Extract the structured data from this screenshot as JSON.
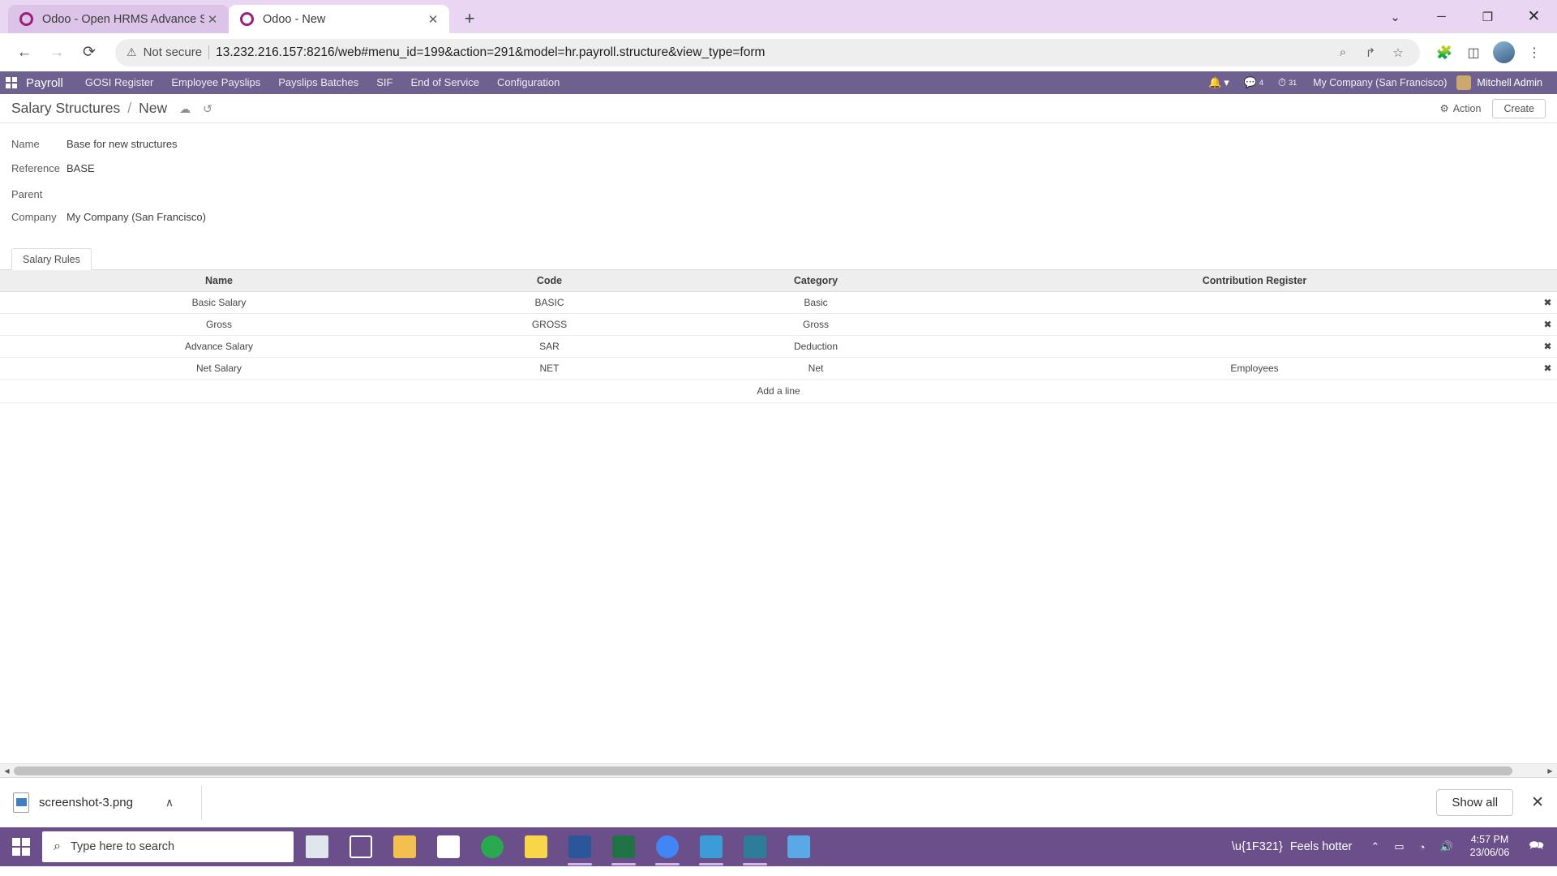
{
  "browser": {
    "tabs": [
      {
        "title": "Odoo - Open HRMS Advance Sal",
        "favicon": "odoo-favicon",
        "active": false,
        "close_label": "✕"
      },
      {
        "title": "Odoo - New",
        "favicon": "odoo-favicon",
        "active": true,
        "close_label": "✕"
      }
    ],
    "new_tab_label": "+",
    "window_controls": {
      "minimize": "─",
      "maximize": "❐",
      "close": "✕",
      "tab_search": "⌄"
    },
    "nav": {
      "back": "←",
      "forward": "→",
      "reload": "⟳"
    },
    "omnibox": {
      "warning_icon": "⚠",
      "security_label": "Not secure",
      "url": "13.232.216.157:8216/web#menu_id=199&action=291&model=hr.payroll.structure&view_type=form",
      "zoom_icon": "⌕",
      "share_icon": "↱",
      "bookmark_icon": "☆"
    },
    "toolbar_icons": {
      "extensions": "🧩",
      "sidepanel": "◫",
      "menu": "⋮"
    }
  },
  "odoo": {
    "brand": "Payroll",
    "menu_items": [
      "GOSI Register",
      "Employee Payslips",
      "Payslips Batches",
      "SIF",
      "End of Service",
      "Configuration"
    ],
    "systray": {
      "bell_icon": "🔔",
      "bell_caret": "▾",
      "messages_icon": "💬",
      "messages_count": "4",
      "activities_icon": "⏱",
      "activities_count": "31",
      "company": "My Company (San Francisco)",
      "user": "Mitchell Admin"
    },
    "control_panel": {
      "breadcrumb_parent": "Salary Structures",
      "breadcrumb_sep": "/",
      "breadcrumb_current": "New",
      "save_icon": "☁",
      "discard_icon": "↺",
      "action_icon": "⚙",
      "action_label": "Action",
      "create_label": "Create"
    },
    "form": {
      "fields": [
        {
          "label": "Name",
          "value": "Base for new structures"
        },
        {
          "label": "Reference",
          "value": "BASE"
        },
        {
          "label": "Parent",
          "value": ""
        },
        {
          "label": "Company",
          "value": "My Company (San Francisco)"
        }
      ]
    },
    "notebook": {
      "tabs": [
        "Salary Rules"
      ],
      "active_tab": "Salary Rules"
    },
    "salary_rules_table": {
      "columns": [
        "Name",
        "Code",
        "Category",
        "Contribution Register"
      ],
      "rows": [
        {
          "name": "Basic Salary",
          "code": "BASIC",
          "category": "Basic",
          "register": "",
          "delete_icon": "✖"
        },
        {
          "name": "Gross",
          "code": "GROSS",
          "category": "Gross",
          "register": "",
          "delete_icon": "✖"
        },
        {
          "name": "Advance Salary",
          "code": "SAR",
          "category": "Deduction",
          "register": "",
          "delete_icon": "✖"
        },
        {
          "name": "Net Salary",
          "code": "NET",
          "category": "Net",
          "register": "Employees",
          "delete_icon": "✖"
        }
      ],
      "add_line_label": "Add a line"
    },
    "scrollbar": {
      "left_arrow": "◀",
      "right_arrow": "▶"
    }
  },
  "download_shelf": {
    "file_name": "screenshot-3.png",
    "caret": "∧",
    "show_all_label": "Show all",
    "close_label": "✕"
  },
  "taskbar": {
    "start_label": "windows-start",
    "search_icon": "⌕",
    "search_placeholder": "Type here to search",
    "apps": [
      {
        "name": "cortana-task-icon",
        "color": "#e8e8e8"
      },
      {
        "name": "task-view-icon",
        "color": "#ffffff"
      },
      {
        "name": "file-explorer-icon",
        "color": "#f3bf4e"
      },
      {
        "name": "microsoft-store-icon",
        "color": "#ffffff"
      },
      {
        "name": "chrome-canary-icon",
        "color": "#2aa84f"
      },
      {
        "name": "sticky-notes-icon",
        "color": "#f7d64a"
      },
      {
        "name": "word-icon",
        "color": "#2b579a"
      },
      {
        "name": "excel-icon",
        "color": "#217346"
      },
      {
        "name": "chrome-icon",
        "color": "#4285f4"
      },
      {
        "name": "vscode-icon",
        "color": "#3c9cd7"
      },
      {
        "name": "terminal-icon",
        "color": "#2d7d9a"
      },
      {
        "name": "photos-icon",
        "color": "#5aa9e6"
      }
    ],
    "weather_label": "Feels hotter",
    "tray": {
      "chevron_up": "⌃",
      "battery": "▭",
      "network": "◔",
      "volume": "🔊",
      "notifications": "🗪"
    },
    "clock_time": "4:57 PM",
    "clock_date": "23/06/06"
  },
  "colors": {
    "odoo_purple": "#6e6190",
    "tabstrip_lilac": "#e9d6f2",
    "tab_inactive": "#dcc3e8",
    "taskbar_purple": "#6b4f8a",
    "table_header": "#eeeeee"
  }
}
